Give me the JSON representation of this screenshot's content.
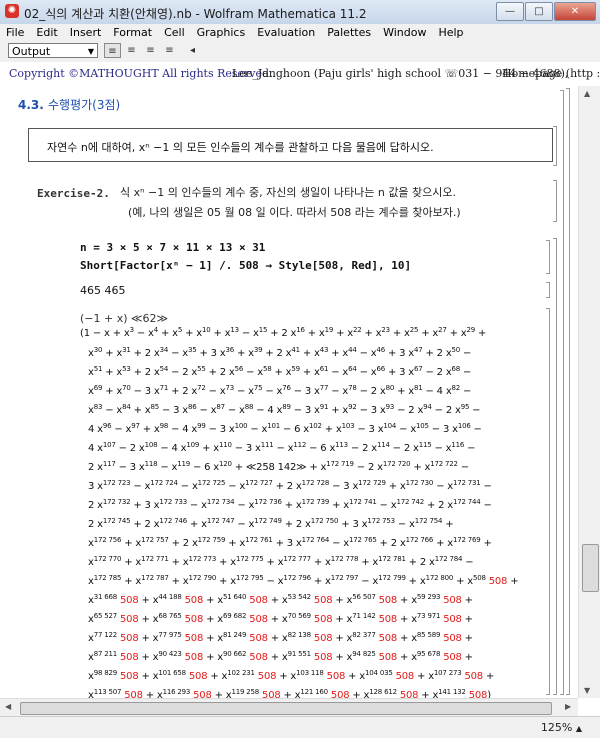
{
  "window": {
    "title": "02_식의 계산과 치환(안채영).nb - Wolfram Mathematica 11.2",
    "app_icon": "mathematica-icon",
    "buttons": [
      "—",
      "□",
      "✕"
    ]
  },
  "menu": [
    "File",
    "Edit",
    "Insert",
    "Format",
    "Cell",
    "Graphics",
    "Evaluation",
    "Palettes",
    "Window",
    "Help"
  ],
  "toolbar": {
    "style_value": "Output",
    "align_buttons": [
      "≡",
      "≡",
      "≡",
      "≡"
    ],
    "arrow": "◂"
  },
  "copyright": {
    "part1": "Copyright ©MATHOUGHT All rights Reserved.",
    "part2": "Lee_Janghoon (Paju girls' high school ☏031 − 944 − 4688),",
    "part3": "Homepage (http : /"
  },
  "section": {
    "number": "4.3.",
    "title": "수행평가(3점)"
  },
  "question_box": "자연수 n에 대하여, xⁿ −1 의 모든 인수들의 계수를 관찰하고 다음 물음에 답하시오.",
  "exercise": {
    "label": "Exercise-2.",
    "line1": "식 xⁿ −1 의 인수들의 계수 중, 자신의 생일이 나타나는 n 값을 찾으시오.",
    "line2": "(예, 나의 생일은 05 월 08 일 이다. 따라서 508 라는 계수를 찾아보자.)"
  },
  "input": {
    "line1": "n = 3 × 5 × 7 × 11 × 13 × 31",
    "line2": "Short[Factor[xⁿ − 1] /. 508 → Style[508, Red], 10]"
  },
  "output_n": "465 465",
  "output_head": "(−1 + x)  ≪62≫",
  "highlight_value": "508",
  "status": {
    "zoom": "125%"
  }
}
